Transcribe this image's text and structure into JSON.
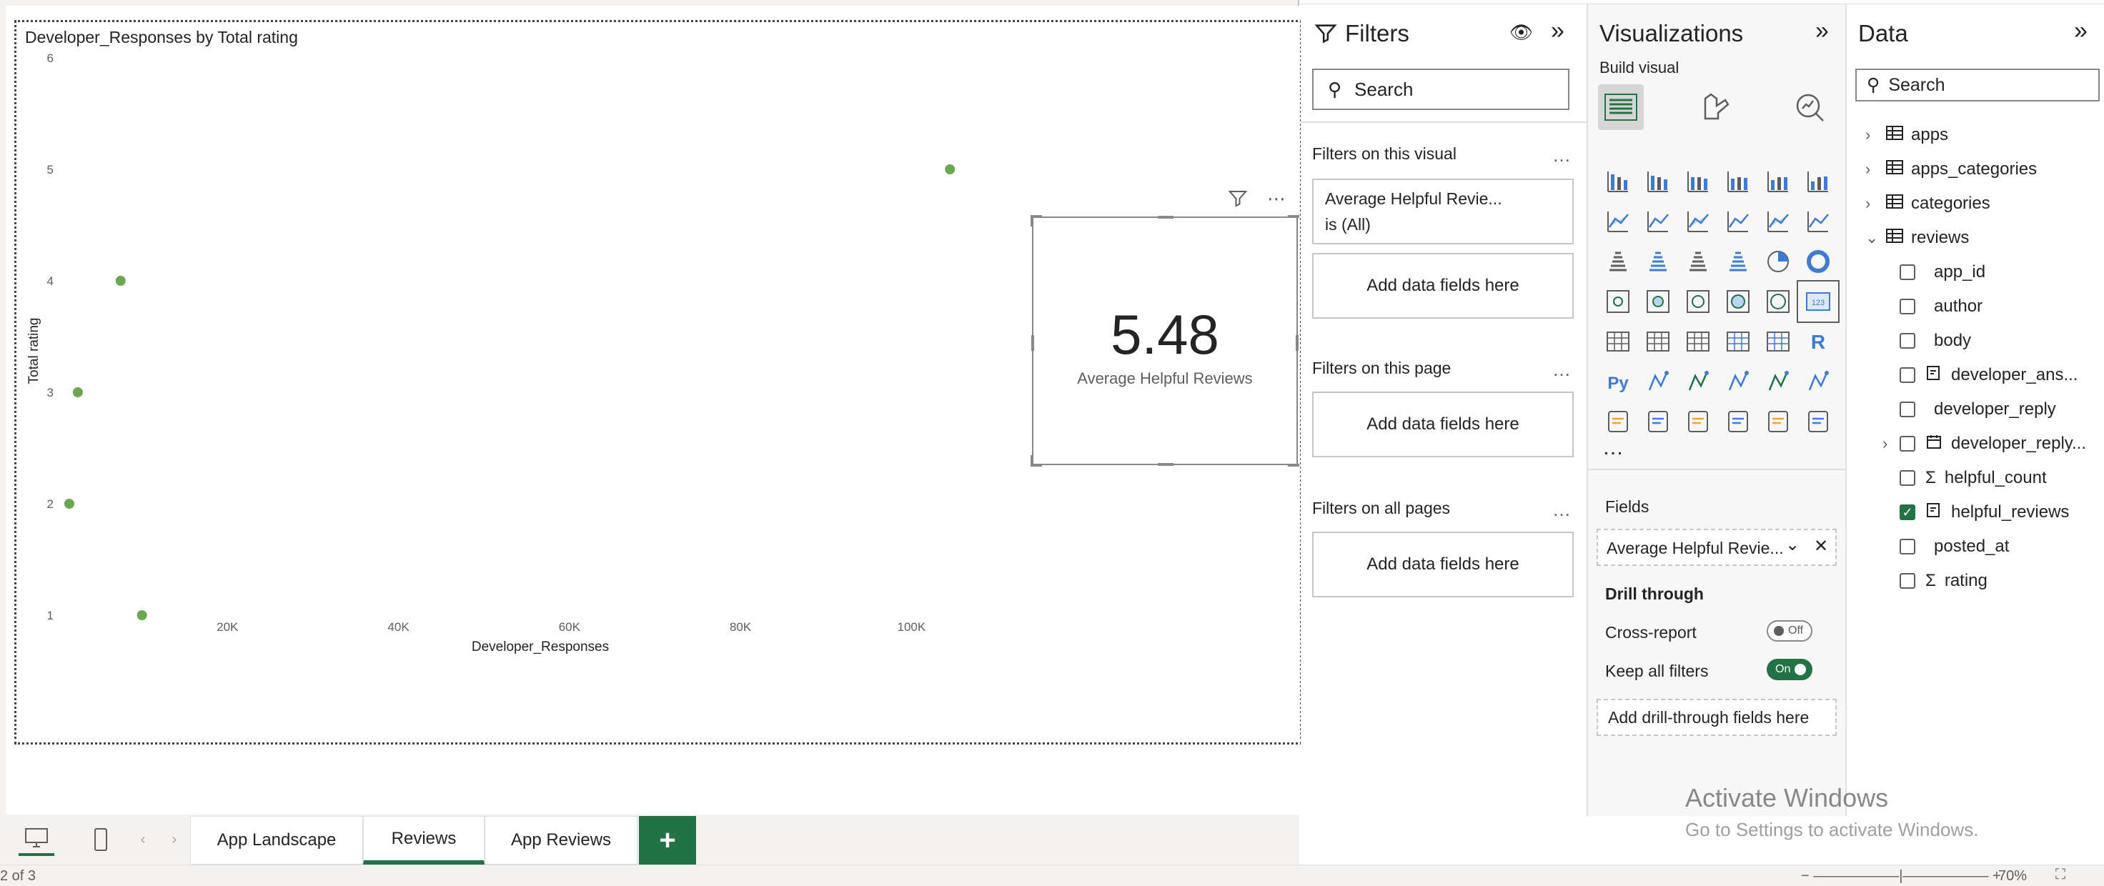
{
  "scatter": {
    "title": "Developer_Responses by Total rating",
    "x_axis_label": "Developer_Responses",
    "y_axis_label": "Total rating"
  },
  "chart_data": {
    "type": "scatter",
    "title": "Developer_Responses by Total rating",
    "xlabel": "Developer_Responses",
    "ylabel": "Total rating",
    "x_ticks": [
      "20K",
      "40K",
      "60K",
      "80K",
      "100K"
    ],
    "y_ticks": [
      "1",
      "2",
      "3",
      "4",
      "5",
      "6"
    ],
    "xlim": [
      0,
      110000
    ],
    "ylim": [
      1,
      6
    ],
    "grid": false,
    "point_color": "#6aa84f",
    "points": [
      {
        "x": 1500,
        "y": 2
      },
      {
        "x": 2500,
        "y": 3
      },
      {
        "x": 7500,
        "y": 4
      },
      {
        "x": 10000,
        "y": 1
      },
      {
        "x": 104500,
        "y": 5
      }
    ]
  },
  "card": {
    "value": "5.48",
    "label": "Average Helpful Reviews"
  },
  "tabs": {
    "items": [
      "App Landscape",
      "Reviews",
      "App Reviews"
    ],
    "active": "Reviews",
    "add_label": "+"
  },
  "status": {
    "page_info": "2 of 3",
    "zoom": "70%"
  },
  "filters": {
    "title": "Filters",
    "search_placeholder": "Search",
    "on_visual": "Filters on this visual",
    "filter_card_line1": "Average Helpful Revie...",
    "filter_card_line2": "is (All)",
    "add_fields": "Add data fields here",
    "on_page": "Filters on this page",
    "on_all_pages": "Filters on all pages",
    "dots": "…"
  },
  "viz": {
    "title": "Visualizations",
    "build_visual": "Build visual",
    "more": "…",
    "fields_label": "Fields",
    "field_chip": "Average Helpful Revie...",
    "drill_through": "Drill through",
    "cross_report": "Cross-report",
    "cross_report_state": "Off",
    "keep_all_filters": "Keep all filters",
    "keep_all_state": "On",
    "add_drill": "Add drill-through fields here"
  },
  "data": {
    "title": "Data",
    "search_placeholder": "Search",
    "tables": [
      "apps",
      "apps_categories",
      "categories",
      "reviews"
    ],
    "fields": [
      {
        "name": "app_id",
        "icon": "",
        "checked": false
      },
      {
        "name": "author",
        "icon": "",
        "checked": false
      },
      {
        "name": "body",
        "icon": "",
        "checked": false
      },
      {
        "name": "developer_ans...",
        "icon": "measure-icon",
        "checked": false
      },
      {
        "name": "developer_reply",
        "icon": "",
        "checked": false
      },
      {
        "name": "developer_reply...",
        "icon": "calendar-icon",
        "checked": false
      },
      {
        "name": "helpful_count",
        "icon": "sigma-icon",
        "checked": false
      },
      {
        "name": "helpful_reviews",
        "icon": "measure-icon",
        "checked": true
      },
      {
        "name": "posted_at",
        "icon": "",
        "checked": false
      },
      {
        "name": "rating",
        "icon": "sigma-icon",
        "checked": false
      }
    ]
  },
  "watermark": {
    "title": "Activate Windows",
    "subtitle": "Go to Settings to activate Windows."
  }
}
